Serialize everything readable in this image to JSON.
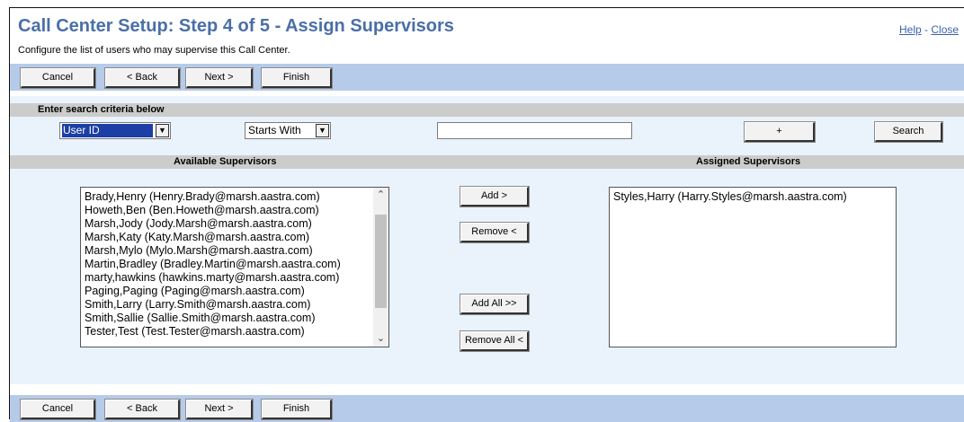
{
  "header": {
    "title": "Call Center Setup: Step 4 of 5 - Assign Supervisors",
    "subtitle": "Configure the list of users who may supervise this Call Center.",
    "help_link": "Help",
    "separator": "-",
    "close_link": "Close"
  },
  "nav_buttons": {
    "cancel": "Cancel",
    "back": "< Back",
    "next": "Next >",
    "finish": "Finish"
  },
  "search": {
    "header": "Enter search criteria below",
    "field_select": "User ID",
    "mode_select": "Starts With",
    "value": "",
    "plus_button": "+",
    "search_button": "Search"
  },
  "supervisors": {
    "available_label": "Available Supervisors",
    "assigned_label": "Assigned Supervisors",
    "available": [
      "Brady,Henry (Henry.Brady@marsh.aastra.com)",
      "Howeth,Ben (Ben.Howeth@marsh.aastra.com)",
      "Marsh,Jody (Jody.Marsh@marsh.aastra.com)",
      "Marsh,Katy (Katy.Marsh@marsh.aastra.com)",
      "Marsh,Mylo (Mylo.Marsh@marsh.aastra.com)",
      "Martin,Bradley (Bradley.Martin@marsh.aastra.com)",
      "marty,hawkins (hawkins.marty@marsh.aastra.com)",
      "Paging,Paging (Paging@marsh.aastra.com)",
      "Smith,Larry (Larry.Smith@marsh.aastra.com)",
      "Smith,Sallie (Sallie.Smith@marsh.aastra.com)",
      "Tester,Test (Test.Tester@marsh.aastra.com)"
    ],
    "assigned": [
      "Styles,Harry (Harry.Styles@marsh.aastra.com)"
    ],
    "add_button": "Add >",
    "remove_button": "Remove <",
    "add_all_button": "Add All >>",
    "remove_all_button": "Remove All <"
  },
  "colors": {
    "title": "#4a6fa8",
    "button_bar": "#b6cbe9",
    "panel": "#eaf3fb",
    "section_header": "#cccccc",
    "selected_option": "#1c3fa6"
  },
  "icons": {
    "dropdown": "chevron-down-icon",
    "scroll_up": "chevron-up-icon",
    "scroll_down": "chevron-down-icon"
  }
}
